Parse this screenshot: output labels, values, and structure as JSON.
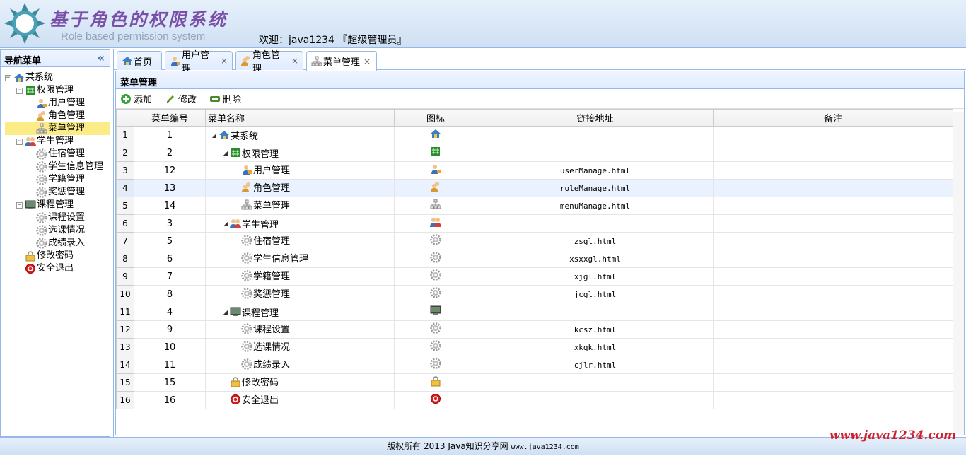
{
  "header": {
    "title_cn": "基于角色的权限系统",
    "title_en": "Role based permission system",
    "welcome": "欢迎：java1234 『超级管理员』"
  },
  "west": {
    "title": "导航菜单",
    "collapse": "«",
    "tree": [
      {
        "label": "某系统",
        "icon": "home-icon",
        "level": 0,
        "toggle": "−"
      },
      {
        "label": "权限管理",
        "icon": "grid-icon",
        "level": 1,
        "toggle": "−"
      },
      {
        "label": "用户管理",
        "icon": "user-icon",
        "level": 2
      },
      {
        "label": "角色管理",
        "icon": "users-icon",
        "level": 2
      },
      {
        "label": "菜单管理",
        "icon": "sitemap-icon",
        "level": 2,
        "selected": true
      },
      {
        "label": "学生管理",
        "icon": "group-icon",
        "level": 1,
        "toggle": "−"
      },
      {
        "label": "住宿管理",
        "icon": "gear-icon",
        "level": 2
      },
      {
        "label": "学生信息管理",
        "icon": "gear-icon",
        "level": 2
      },
      {
        "label": "学籍管理",
        "icon": "gear-icon",
        "level": 2
      },
      {
        "label": "奖惩管理",
        "icon": "gear-icon",
        "level": 2
      },
      {
        "label": "课程管理",
        "icon": "monitor-icon",
        "level": 1,
        "toggle": "−"
      },
      {
        "label": "课程设置",
        "icon": "gear-icon",
        "level": 2
      },
      {
        "label": "选课情况",
        "icon": "gear-icon",
        "level": 2
      },
      {
        "label": "成绩录入",
        "icon": "gear-icon",
        "level": 2
      },
      {
        "label": "修改密码",
        "icon": "lock-icon",
        "level": 1
      },
      {
        "label": "安全退出",
        "icon": "exit-icon",
        "level": 1
      }
    ]
  },
  "tabs": [
    {
      "label": "首页",
      "icon": "home-icon",
      "closable": false
    },
    {
      "label": "用户管理",
      "icon": "user-icon",
      "closable": true
    },
    {
      "label": "角色管理",
      "icon": "users-icon",
      "closable": true
    },
    {
      "label": "菜单管理",
      "icon": "sitemap-icon",
      "closable": true,
      "active": true
    }
  ],
  "panel": {
    "title": "菜单管理"
  },
  "toolbar": {
    "add": "添加",
    "edit": "修改",
    "delete": "删除"
  },
  "grid": {
    "columns": [
      "菜单编号",
      "菜单名称",
      "图标",
      "链接地址",
      "备注"
    ],
    "rows": [
      {
        "n": "1",
        "id": "1",
        "name": "某系统",
        "icon": "home-icon",
        "url": "",
        "note": "",
        "depth": 0,
        "expand": true
      },
      {
        "n": "2",
        "id": "2",
        "name": "权限管理",
        "icon": "grid-icon",
        "url": "",
        "note": "",
        "depth": 1,
        "expand": true
      },
      {
        "n": "3",
        "id": "12",
        "name": "用户管理",
        "icon": "user-icon",
        "url": "userManage.html",
        "note": "",
        "depth": 2
      },
      {
        "n": "4",
        "id": "13",
        "name": "角色管理",
        "icon": "users-icon",
        "url": "roleManage.html",
        "note": "",
        "depth": 2,
        "hover": true
      },
      {
        "n": "5",
        "id": "14",
        "name": "菜单管理",
        "icon": "sitemap-icon",
        "url": "menuManage.html",
        "note": "",
        "depth": 2
      },
      {
        "n": "6",
        "id": "3",
        "name": "学生管理",
        "icon": "group-icon",
        "url": "",
        "note": "",
        "depth": 1,
        "expand": true
      },
      {
        "n": "7",
        "id": "5",
        "name": "住宿管理",
        "icon": "gear-icon",
        "url": "zsgl.html",
        "note": "",
        "depth": 2
      },
      {
        "n": "8",
        "id": "6",
        "name": "学生信息管理",
        "icon": "gear-icon",
        "url": "xsxxgl.html",
        "note": "",
        "depth": 2
      },
      {
        "n": "9",
        "id": "7",
        "name": "学籍管理",
        "icon": "gear-icon",
        "url": "xjgl.html",
        "note": "",
        "depth": 2
      },
      {
        "n": "10",
        "id": "8",
        "name": "奖惩管理",
        "icon": "gear-icon",
        "url": "jcgl.html",
        "note": "",
        "depth": 2
      },
      {
        "n": "11",
        "id": "4",
        "name": "课程管理",
        "icon": "monitor-icon",
        "url": "",
        "note": "",
        "depth": 1,
        "expand": true
      },
      {
        "n": "12",
        "id": "9",
        "name": "课程设置",
        "icon": "gear-icon",
        "url": "kcsz.html",
        "note": "",
        "depth": 2
      },
      {
        "n": "13",
        "id": "10",
        "name": "选课情况",
        "icon": "gear-icon",
        "url": "xkqk.html",
        "note": "",
        "depth": 2
      },
      {
        "n": "14",
        "id": "11",
        "name": "成绩录入",
        "icon": "gear-icon",
        "url": "cjlr.html",
        "note": "",
        "depth": 2
      },
      {
        "n": "15",
        "id": "15",
        "name": "修改密码",
        "icon": "lock-icon",
        "url": "",
        "note": "",
        "depth": 1
      },
      {
        "n": "16",
        "id": "16",
        "name": "安全退出",
        "icon": "exit-icon",
        "url": "",
        "note": "",
        "depth": 1
      }
    ]
  },
  "footer": {
    "text": "版权所有 2013 Java知识分享网 ",
    "link": "www.java1234.com"
  },
  "watermark": "www.java1234.com",
  "colors": {
    "accent": "#95b8e7",
    "selected": "#fbec88",
    "title": "#7a4fa8",
    "watermark": "#d0202a"
  }
}
